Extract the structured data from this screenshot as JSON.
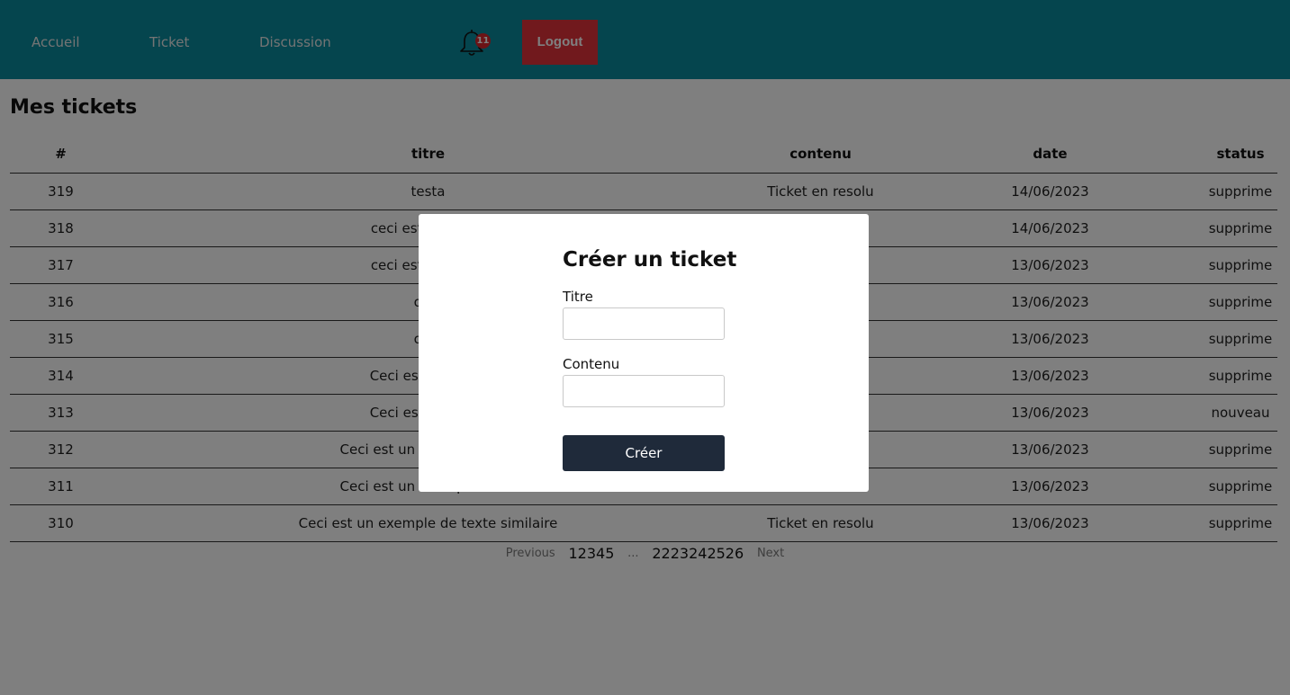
{
  "nav": {
    "links": [
      "Accueil",
      "Ticket",
      "Discussion"
    ],
    "notification_count": "11",
    "logout_label": "Logout"
  },
  "main": {
    "title": "Mes tickets",
    "columns": [
      "#",
      "titre",
      "contenu",
      "date",
      "status"
    ],
    "rows": [
      [
        "319",
        "testa",
        "Ticket en resolu",
        "14/06/2023",
        "supprime"
      ],
      [
        "318",
        "ceci est un exem",
        "",
        "14/06/2023",
        "supprime"
      ],
      [
        "317",
        "ceci est un exem",
        "",
        "13/06/2023",
        "supprime"
      ],
      [
        "316",
        "oool",
        "",
        "13/06/2023",
        "supprime"
      ],
      [
        "315",
        "oool",
        "",
        "13/06/2023",
        "supprime"
      ],
      [
        "314",
        "Ceci est un exem",
        "",
        "13/06/2023",
        "supprime"
      ],
      [
        "313",
        "Ceci est un exem",
        "",
        "13/06/2023",
        "nouveau"
      ],
      [
        "312",
        "Ceci est un exemple de te",
        "",
        "13/06/2023",
        "supprime"
      ],
      [
        "311",
        "Ceci est un exemple de te",
        "",
        "13/06/2023",
        "supprime"
      ],
      [
        "310",
        "Ceci est un exemple de texte similaire",
        "Ticket en resolu",
        "13/06/2023",
        "supprime"
      ]
    ]
  },
  "pagination": {
    "previous": "Previous",
    "first_pages": "12345",
    "ellipsis": "...",
    "last_pages": "2223242526",
    "next": "Next"
  },
  "modal": {
    "title": "Créer un ticket",
    "titre_label": "Titre",
    "titre_value": "",
    "contenu_label": "Contenu",
    "contenu_value": "",
    "submit_label": "Créer"
  },
  "colors": {
    "header": "#0b8a9c",
    "logout": "#e3323a",
    "badge": "#d9262c",
    "submit": "#1f2a3a"
  }
}
